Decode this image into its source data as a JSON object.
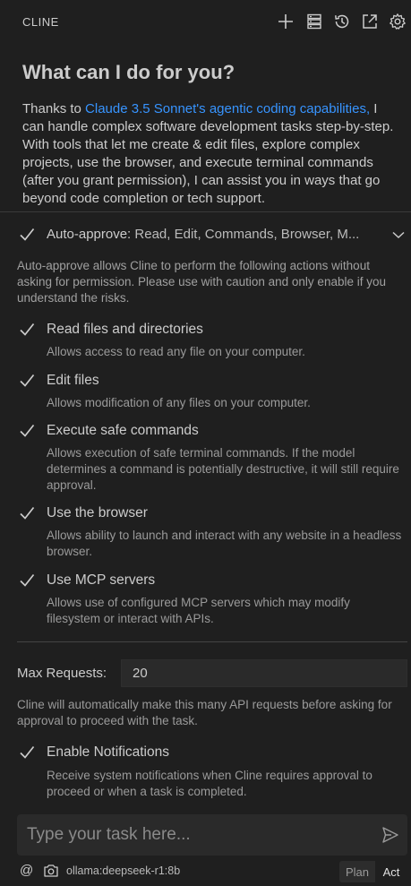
{
  "header": {
    "title": "CLINE",
    "icons": [
      "plus-icon",
      "server-icon",
      "history-icon",
      "popout-icon",
      "gear-icon"
    ]
  },
  "welcome": {
    "heading": "What can I do for you?",
    "intro_prefix": "Thanks to ",
    "intro_link": "Claude 3.5 Sonnet's agentic coding capabilities,",
    "intro_rest": " I can handle complex software development tasks step-by-step. With tools that let me create & edit files, explore complex projects, use the browser, and execute terminal commands (after you grant permission), I can assist you in ways that go beyond code completion or tech support."
  },
  "auto_approve": {
    "checked": true,
    "label": "Auto-approve:",
    "summary": "Read, Edit, Commands, Browser, M...",
    "description": "Auto-approve allows Cline to perform the following actions without asking for permission. Please use with caution and only enable if you understand the risks.",
    "options": [
      {
        "title": "Read files and directories",
        "description": "Allows access to read any file on your computer.",
        "checked": true
      },
      {
        "title": "Edit files",
        "description": "Allows modification of any files on your computer.",
        "checked": true
      },
      {
        "title": "Execute safe commands",
        "description": "Allows execution of safe terminal commands. If the model determines a command is potentially destructive, it will still require approval.",
        "checked": true
      },
      {
        "title": "Use the browser",
        "description": "Allows ability to launch and interact with any website in a headless browser.",
        "checked": true
      },
      {
        "title": "Use MCP servers",
        "description": "Allows use of configured MCP servers which may modify filesystem or interact with APIs.",
        "checked": true
      }
    ],
    "max_requests_label": "Max Requests:",
    "max_requests_value": "20",
    "max_requests_description": "Cline will automatically make this many API requests before asking for approval to proceed with the task.",
    "notifications": {
      "title": "Enable Notifications",
      "description": "Receive system notifications when Cline requires approval to proceed or when a task is completed.",
      "checked": true
    }
  },
  "composer": {
    "placeholder": "Type your task here...",
    "model": "ollama:deepseek-r1:8b",
    "at_symbol": "@",
    "modes": {
      "plan": "Plan",
      "act": "Act",
      "active": "act"
    }
  },
  "colors": {
    "background": "#1f1f1f",
    "link": "#3794ff",
    "text": "#cccccc"
  }
}
